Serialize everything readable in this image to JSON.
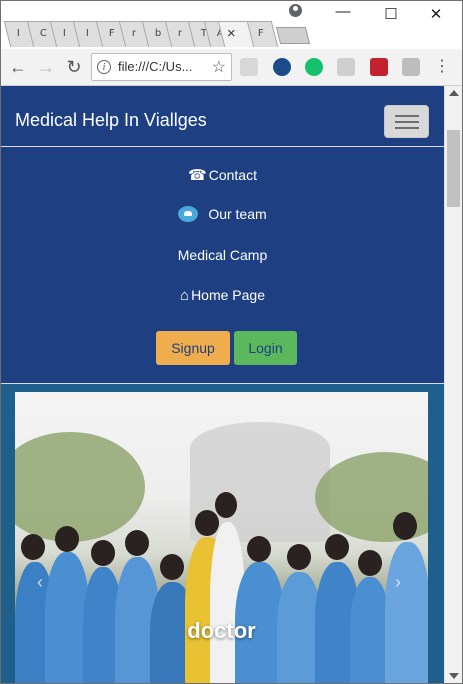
{
  "browser": {
    "tabs": [
      {
        "label": "I"
      },
      {
        "label": "C"
      },
      {
        "label": "I"
      },
      {
        "label": "I"
      },
      {
        "label": "F"
      },
      {
        "label": "r"
      },
      {
        "label": "b"
      },
      {
        "label": "r"
      },
      {
        "label": "T"
      },
      {
        "label": "A"
      },
      {
        "label": "×"
      },
      {
        "label": "F"
      }
    ],
    "controls": {
      "minimize": "—",
      "maximize": "☐",
      "close": "✕"
    },
    "address": {
      "info_glyph": "i",
      "url": "file:///C:/Us..."
    },
    "nav": {
      "back": "←",
      "forward": "→",
      "reload": "↻"
    },
    "menu": "⋮"
  },
  "site": {
    "brand": "Medical Help In Viallges",
    "nav_items": [
      {
        "label": "Contact",
        "icon": "telephone-icon"
      },
      {
        "label": "Our team",
        "icon": "team-icon"
      },
      {
        "label": "Medical Camp",
        "icon": ""
      },
      {
        "label": "Home Page",
        "icon": "home-icon"
      }
    ],
    "buttons": {
      "signup": "Signup",
      "login": "Login"
    },
    "hero": {
      "caption": "doctor"
    }
  },
  "colors": {
    "navbar": "#1e4082",
    "signup": "#f0ad4e",
    "login": "#5cb85c"
  }
}
